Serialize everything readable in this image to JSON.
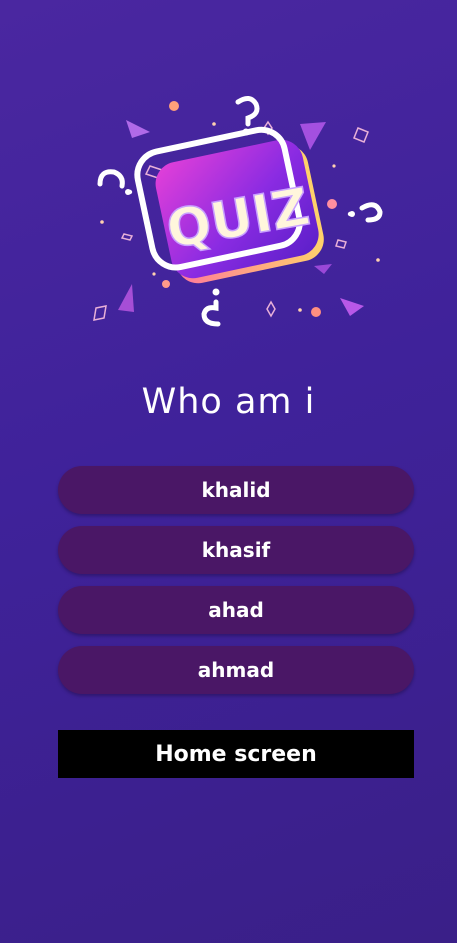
{
  "logo": {
    "text": "QUIZ"
  },
  "question": {
    "title": "Who am i"
  },
  "options": [
    {
      "label": "khalid"
    },
    {
      "label": "khasif"
    },
    {
      "label": "ahad"
    },
    {
      "label": "ahmad"
    }
  ],
  "home_button": {
    "label": "Home screen"
  },
  "colors": {
    "background": "#4127a0",
    "option_button": "#4a1766",
    "home_button": "#000000",
    "text": "#ffffff"
  }
}
